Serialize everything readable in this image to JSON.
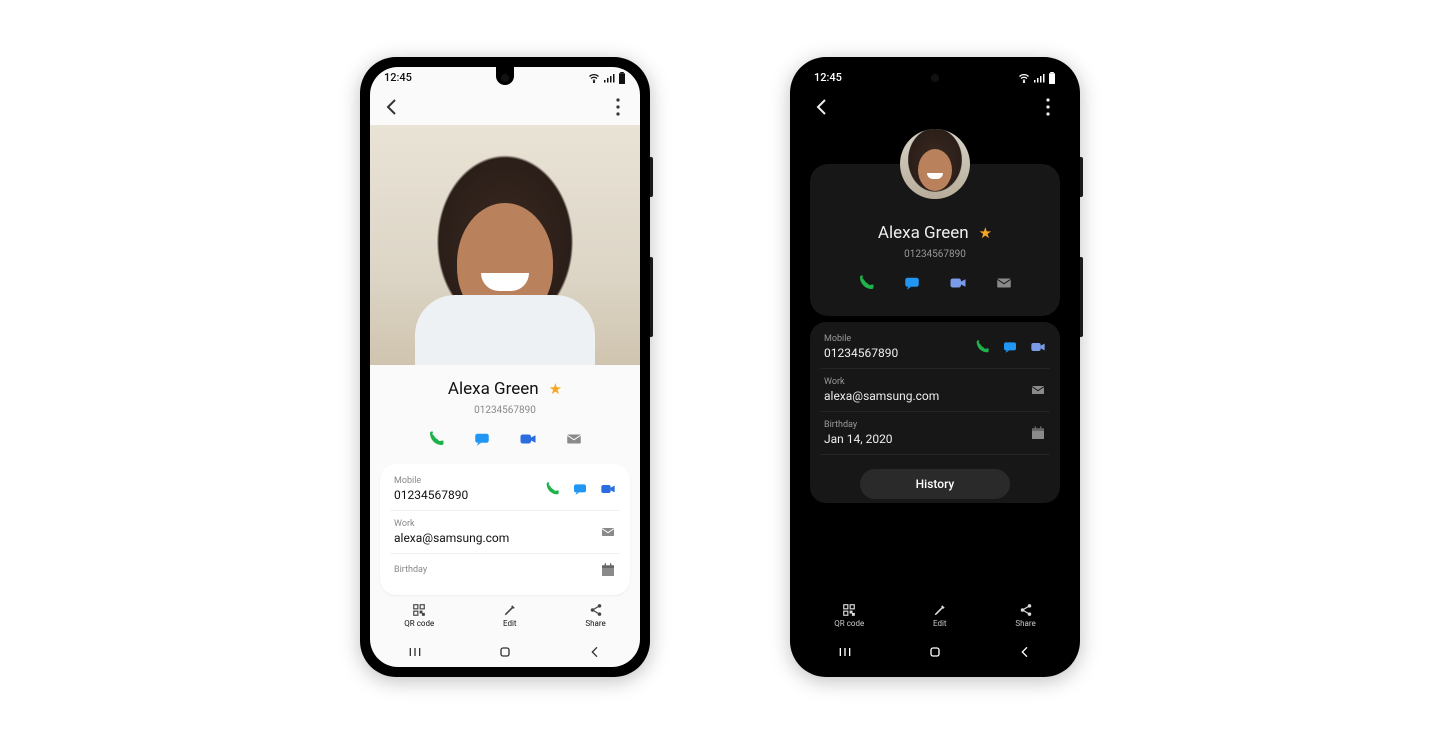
{
  "status": {
    "time": "12:45"
  },
  "contact": {
    "name": "Alexa Green",
    "number": "01234567890"
  },
  "rows": {
    "mobile": {
      "label": "Mobile",
      "value": "01234567890"
    },
    "work": {
      "label": "Work",
      "value": "alexa@samsung.com"
    },
    "birthday_label": "Birthday",
    "birthday_value": "Jan 14, 2020"
  },
  "buttons": {
    "history": "History",
    "qr": "QR code",
    "edit": "Edit",
    "share": "Share"
  },
  "colors": {
    "call": "#1fb24a",
    "msg": "#2196f3",
    "video": "#2b6de0",
    "mail": "#8a8a8a",
    "star": "#f5a623"
  }
}
